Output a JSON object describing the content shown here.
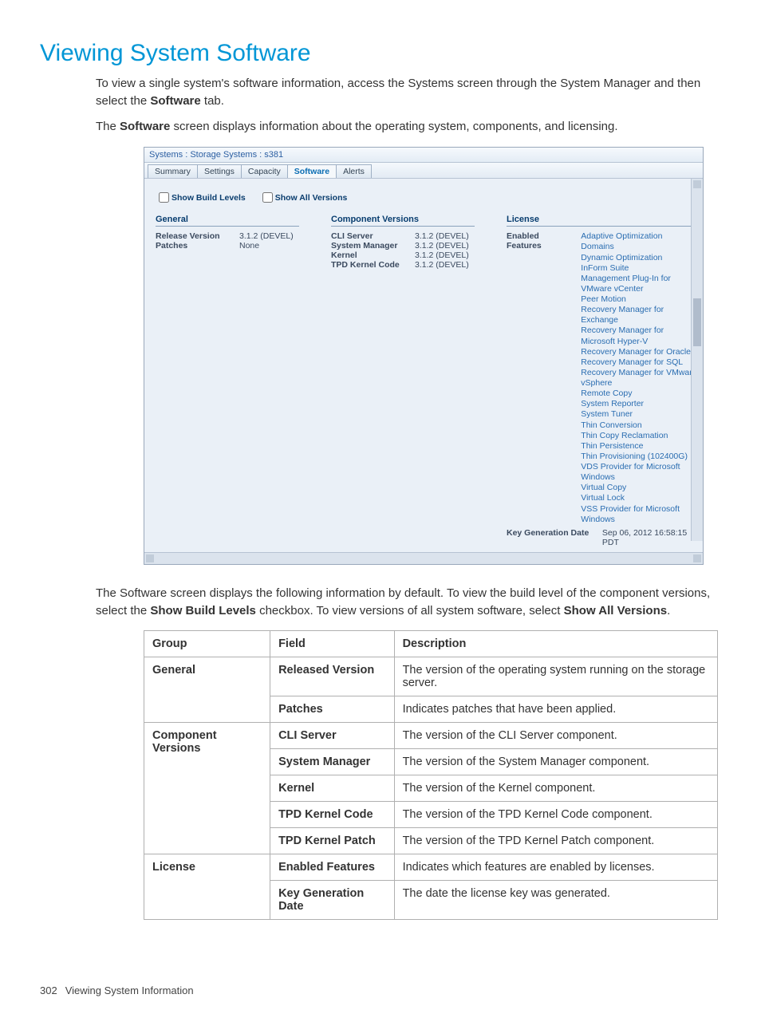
{
  "heading": "Viewing System Software",
  "intro1_a": "To view a single system's software information, access the Systems screen through the System Manager and then select the ",
  "intro1_b_bold": "Software",
  "intro1_c": " tab.",
  "intro2_a": "The ",
  "intro2_b_bold": "Software",
  "intro2_c": " screen displays information about the operating system, components, and licensing.",
  "shot": {
    "breadcrumb": "Systems : Storage Systems : s381",
    "tabs": [
      "Summary",
      "Settings",
      "Capacity",
      "Software",
      "Alerts"
    ],
    "active_tab_index": 3,
    "check1": "Show Build Levels",
    "check2": "Show All Versions",
    "general_head": "General",
    "general": [
      {
        "k": "Release Version",
        "v": "3.1.2 (DEVEL)"
      },
      {
        "k": "Patches",
        "v": "None"
      }
    ],
    "comp_head": "Component Versions",
    "components": [
      {
        "k": "CLI Server",
        "v": "3.1.2 (DEVEL)"
      },
      {
        "k": "System Manager",
        "v": "3.1.2 (DEVEL)"
      },
      {
        "k": "Kernel",
        "v": "3.1.2 (DEVEL)"
      },
      {
        "k": "TPD Kernel Code",
        "v": "3.1.2 (DEVEL)"
      }
    ],
    "lic_head": "License",
    "enabled_label": "Enabled Features",
    "features": [
      "Adaptive Optimization",
      "Domains",
      "Dynamic Optimization",
      "InForm Suite",
      "Management Plug-In for VMware vCenter",
      "Peer Motion",
      "Recovery Manager for Exchange",
      "Recovery Manager for Microsoft Hyper-V",
      "Recovery Manager for Oracle",
      "Recovery Manager for SQL",
      "Recovery Manager for VMware vSphere",
      "Remote Copy",
      "System Reporter",
      "System Tuner",
      "Thin Conversion",
      "Thin Copy Reclamation",
      "Thin Persistence",
      "Thin Provisioning (102400G)",
      "VDS Provider for Microsoft Windows",
      "Virtual Copy",
      "Virtual Lock",
      "VSS Provider for Microsoft Windows"
    ],
    "keygen_label": "Key Generation Date",
    "keygen_value": "Sep 06, 2012 16:58:15 PDT"
  },
  "mid1_a": "The Software screen displays the following information by default. To view the build level of the component versions, select the ",
  "mid1_b_bold": "Show Build Levels",
  "mid1_c": " checkbox. To view versions of all system software, select ",
  "mid1_d_bold": "Show All Versions",
  "mid1_e": ".",
  "table": {
    "headers": [
      "Group",
      "Field",
      "Description"
    ],
    "rows": [
      {
        "group": "General",
        "groupspan": 2,
        "field": "Released Version",
        "desc": "The version of the operating system running on the storage server."
      },
      {
        "field": "Patches",
        "desc": "Indicates patches that have been applied."
      },
      {
        "group": "Component Versions",
        "groupspan": 5,
        "field": "CLI Server",
        "desc": "The version of the CLI Server component."
      },
      {
        "field": "System Manager",
        "desc": "The version of the System Manager component."
      },
      {
        "field": "Kernel",
        "desc": "The version of the Kernel component."
      },
      {
        "field": "TPD Kernel Code",
        "desc": "The version of the TPD Kernel Code component."
      },
      {
        "field": "TPD Kernel Patch",
        "desc": "The version of the TPD Kernel Patch component."
      },
      {
        "group": "License",
        "groupspan": 2,
        "field": "Enabled Features",
        "desc": "Indicates which features are enabled by licenses."
      },
      {
        "field": "Key Generation Date",
        "desc": "The date the license key was generated."
      }
    ]
  },
  "footer_page": "302",
  "footer_text": "Viewing System Information"
}
